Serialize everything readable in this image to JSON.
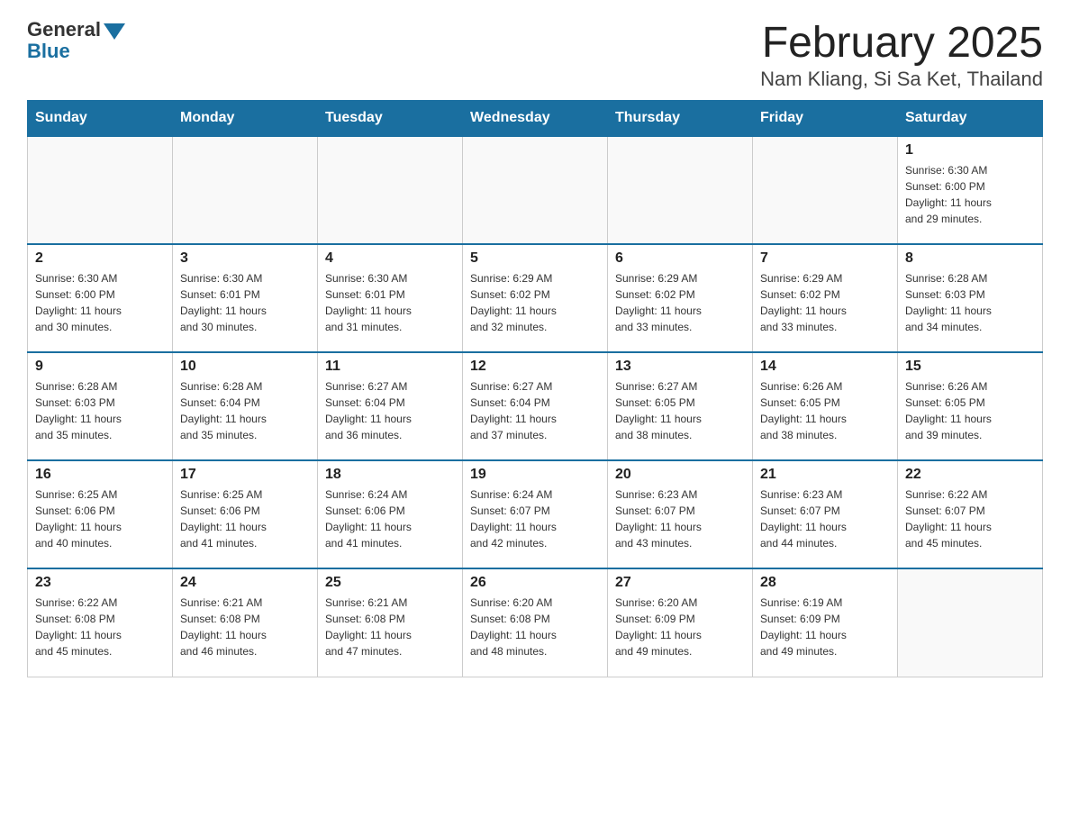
{
  "logo": {
    "general": "General",
    "blue": "Blue"
  },
  "title": "February 2025",
  "location": "Nam Kliang, Si Sa Ket, Thailand",
  "days_of_week": [
    "Sunday",
    "Monday",
    "Tuesday",
    "Wednesday",
    "Thursday",
    "Friday",
    "Saturday"
  ],
  "weeks": [
    [
      {
        "day": "",
        "info": ""
      },
      {
        "day": "",
        "info": ""
      },
      {
        "day": "",
        "info": ""
      },
      {
        "day": "",
        "info": ""
      },
      {
        "day": "",
        "info": ""
      },
      {
        "day": "",
        "info": ""
      },
      {
        "day": "1",
        "info": "Sunrise: 6:30 AM\nSunset: 6:00 PM\nDaylight: 11 hours\nand 29 minutes."
      }
    ],
    [
      {
        "day": "2",
        "info": "Sunrise: 6:30 AM\nSunset: 6:00 PM\nDaylight: 11 hours\nand 30 minutes."
      },
      {
        "day": "3",
        "info": "Sunrise: 6:30 AM\nSunset: 6:01 PM\nDaylight: 11 hours\nand 30 minutes."
      },
      {
        "day": "4",
        "info": "Sunrise: 6:30 AM\nSunset: 6:01 PM\nDaylight: 11 hours\nand 31 minutes."
      },
      {
        "day": "5",
        "info": "Sunrise: 6:29 AM\nSunset: 6:02 PM\nDaylight: 11 hours\nand 32 minutes."
      },
      {
        "day": "6",
        "info": "Sunrise: 6:29 AM\nSunset: 6:02 PM\nDaylight: 11 hours\nand 33 minutes."
      },
      {
        "day": "7",
        "info": "Sunrise: 6:29 AM\nSunset: 6:02 PM\nDaylight: 11 hours\nand 33 minutes."
      },
      {
        "day": "8",
        "info": "Sunrise: 6:28 AM\nSunset: 6:03 PM\nDaylight: 11 hours\nand 34 minutes."
      }
    ],
    [
      {
        "day": "9",
        "info": "Sunrise: 6:28 AM\nSunset: 6:03 PM\nDaylight: 11 hours\nand 35 minutes."
      },
      {
        "day": "10",
        "info": "Sunrise: 6:28 AM\nSunset: 6:04 PM\nDaylight: 11 hours\nand 35 minutes."
      },
      {
        "day": "11",
        "info": "Sunrise: 6:27 AM\nSunset: 6:04 PM\nDaylight: 11 hours\nand 36 minutes."
      },
      {
        "day": "12",
        "info": "Sunrise: 6:27 AM\nSunset: 6:04 PM\nDaylight: 11 hours\nand 37 minutes."
      },
      {
        "day": "13",
        "info": "Sunrise: 6:27 AM\nSunset: 6:05 PM\nDaylight: 11 hours\nand 38 minutes."
      },
      {
        "day": "14",
        "info": "Sunrise: 6:26 AM\nSunset: 6:05 PM\nDaylight: 11 hours\nand 38 minutes."
      },
      {
        "day": "15",
        "info": "Sunrise: 6:26 AM\nSunset: 6:05 PM\nDaylight: 11 hours\nand 39 minutes."
      }
    ],
    [
      {
        "day": "16",
        "info": "Sunrise: 6:25 AM\nSunset: 6:06 PM\nDaylight: 11 hours\nand 40 minutes."
      },
      {
        "day": "17",
        "info": "Sunrise: 6:25 AM\nSunset: 6:06 PM\nDaylight: 11 hours\nand 41 minutes."
      },
      {
        "day": "18",
        "info": "Sunrise: 6:24 AM\nSunset: 6:06 PM\nDaylight: 11 hours\nand 41 minutes."
      },
      {
        "day": "19",
        "info": "Sunrise: 6:24 AM\nSunset: 6:07 PM\nDaylight: 11 hours\nand 42 minutes."
      },
      {
        "day": "20",
        "info": "Sunrise: 6:23 AM\nSunset: 6:07 PM\nDaylight: 11 hours\nand 43 minutes."
      },
      {
        "day": "21",
        "info": "Sunrise: 6:23 AM\nSunset: 6:07 PM\nDaylight: 11 hours\nand 44 minutes."
      },
      {
        "day": "22",
        "info": "Sunrise: 6:22 AM\nSunset: 6:07 PM\nDaylight: 11 hours\nand 45 minutes."
      }
    ],
    [
      {
        "day": "23",
        "info": "Sunrise: 6:22 AM\nSunset: 6:08 PM\nDaylight: 11 hours\nand 45 minutes."
      },
      {
        "day": "24",
        "info": "Sunrise: 6:21 AM\nSunset: 6:08 PM\nDaylight: 11 hours\nand 46 minutes."
      },
      {
        "day": "25",
        "info": "Sunrise: 6:21 AM\nSunset: 6:08 PM\nDaylight: 11 hours\nand 47 minutes."
      },
      {
        "day": "26",
        "info": "Sunrise: 6:20 AM\nSunset: 6:08 PM\nDaylight: 11 hours\nand 48 minutes."
      },
      {
        "day": "27",
        "info": "Sunrise: 6:20 AM\nSunset: 6:09 PM\nDaylight: 11 hours\nand 49 minutes."
      },
      {
        "day": "28",
        "info": "Sunrise: 6:19 AM\nSunset: 6:09 PM\nDaylight: 11 hours\nand 49 minutes."
      },
      {
        "day": "",
        "info": ""
      }
    ]
  ]
}
